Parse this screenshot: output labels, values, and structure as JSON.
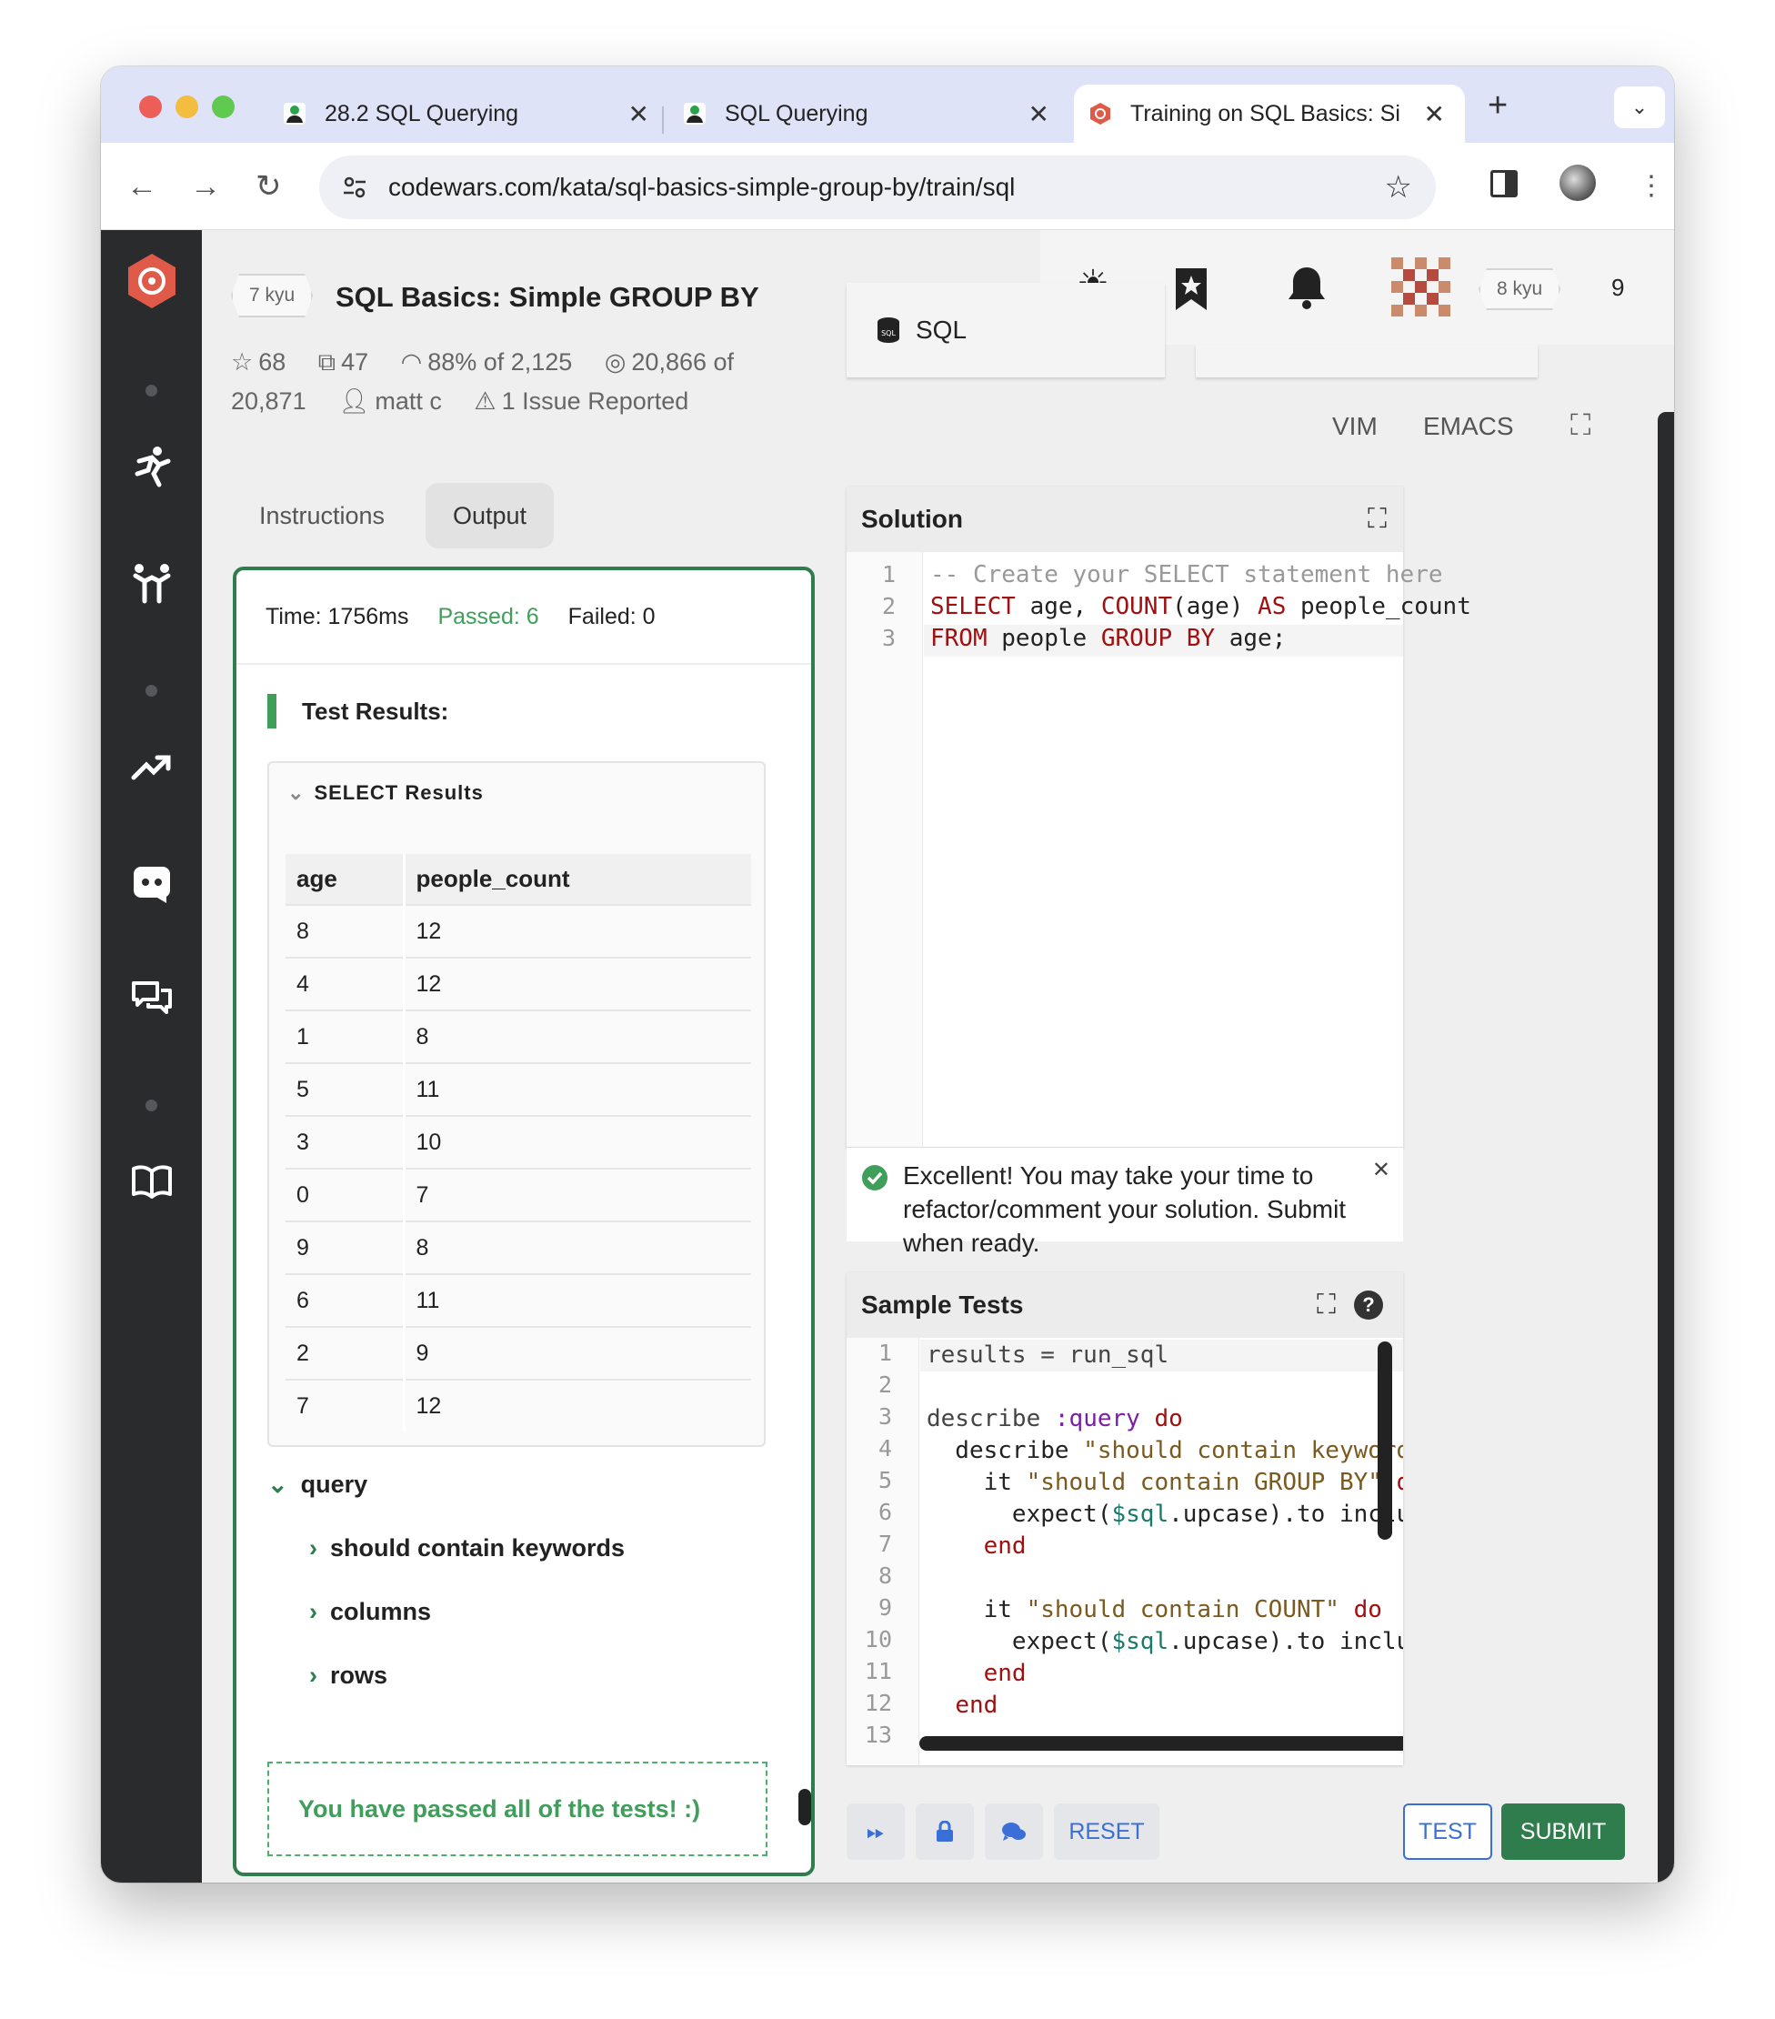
{
  "browser": {
    "tabs": [
      {
        "title": "28.2 SQL Querying"
      },
      {
        "title": "SQL Querying"
      },
      {
        "title": "Training on SQL Basics: Si"
      }
    ],
    "url": "codewars.com/kata/sql-basics-simple-group-by/train/sql"
  },
  "kata": {
    "rank": "7 kyu",
    "title": "SQL Basics: Simple GROUP BY",
    "stars": "68",
    "collections": "47",
    "satisfaction": "88% of 2,125",
    "completions_line1": "20,866 of",
    "completions_line2": "20,871",
    "author": "matt c",
    "issues": "1 Issue Reported"
  },
  "left_tabs": {
    "instructions": "Instructions",
    "output": "Output"
  },
  "output": {
    "time": "Time: 1756ms",
    "passed": "Passed: 6",
    "failed": "Failed: 0",
    "test_results": "Test Results:",
    "select_results": "SELECT Results",
    "columns": [
      "age",
      "people_count"
    ],
    "rows": [
      [
        "8",
        "12"
      ],
      [
        "4",
        "12"
      ],
      [
        "1",
        "8"
      ],
      [
        "5",
        "11"
      ],
      [
        "3",
        "10"
      ],
      [
        "0",
        "7"
      ],
      [
        "9",
        "8"
      ],
      [
        "6",
        "11"
      ],
      [
        "2",
        "9"
      ],
      [
        "7",
        "12"
      ]
    ],
    "tree_root": "query",
    "tree_items": [
      "should contain keywords",
      "columns",
      "rows"
    ],
    "pass_message": "You have passed all of the tests! :)"
  },
  "editor": {
    "language": "SQL",
    "user_rank": "8 kyu",
    "user_honor": "9",
    "vim": "VIM",
    "emacs": "EMACS",
    "solution_title": "Solution",
    "solution_line_numbers": [
      "1",
      "2",
      "3"
    ],
    "notice": "Excellent! You may take your time to refactor/comment your solution. Submit when ready.",
    "tests_title": "Sample Tests",
    "test_line_numbers": [
      "1",
      "2",
      "3",
      "4",
      "5",
      "6",
      "7",
      "8",
      "9",
      "10",
      "11",
      "12",
      "13"
    ]
  },
  "buttons": {
    "reset": "RESET",
    "test": "TEST",
    "submit": "SUBMIT"
  },
  "colors": {
    "accent_green": "#2f7d4c",
    "pass_green": "#3f9e5a",
    "brand_red": "#e05a4a",
    "link_blue": "#3a6fd8"
  }
}
